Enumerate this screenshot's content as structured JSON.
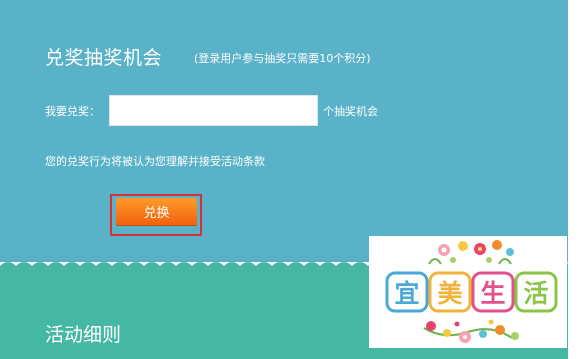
{
  "panel": {
    "title": "兑奖抽奖机会",
    "subtitle": "(登录用户参与抽奖只需要10个积分)",
    "amount_label": "我要兑奖：",
    "amount_value": "",
    "amount_suffix": "个抽奖机会",
    "notice": "您的兑奖行为将被认为您理解并接受活动条款",
    "redeem_button": "兑换"
  },
  "rules": {
    "title": "活动细则"
  },
  "promo": {
    "logo_text": [
      "宜",
      "美",
      "生",
      "活"
    ]
  },
  "colors": {
    "top_panel": "#5ab2c8",
    "bottom_panel": "#45b8a4",
    "button_orange": "#f2620e",
    "highlight_red": "#d6303a"
  }
}
